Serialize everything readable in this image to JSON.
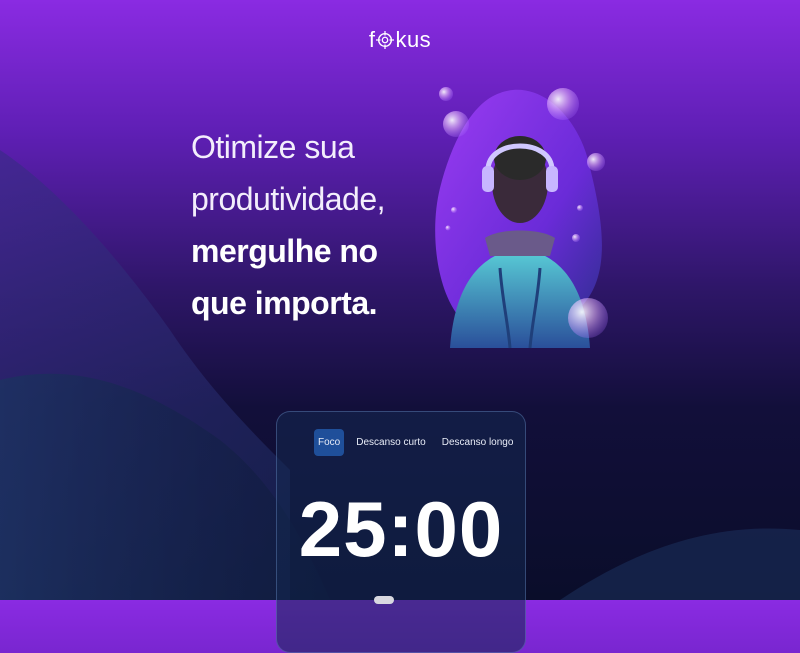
{
  "app": {
    "logo_prefix": "f",
    "logo_suffix": "kus"
  },
  "hero": {
    "line1": "Otimize sua",
    "line2": "produtividade,",
    "line3": "mergulhe no",
    "line4": "que importa."
  },
  "timer": {
    "tabs": [
      {
        "label": "Foco",
        "active": true
      },
      {
        "label": "Descanso curto",
        "active": false
      },
      {
        "label": "Descanso longo",
        "active": false
      }
    ],
    "time": "25:00"
  },
  "colors": {
    "accent": "#8a2be2",
    "active_tab": "#1f4f9a",
    "card_bg": "#142850"
  },
  "icons": {
    "logo_o": "target-icon"
  }
}
